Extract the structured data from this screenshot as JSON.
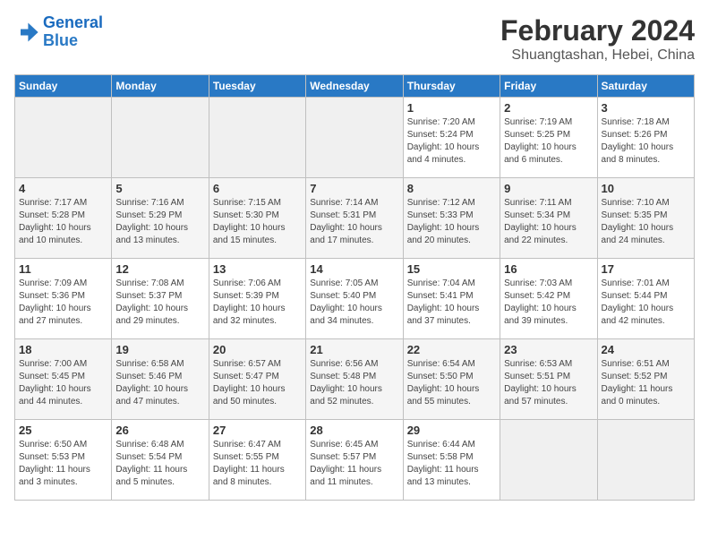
{
  "logo": {
    "line1": "General",
    "line2": "Blue"
  },
  "title": "February 2024",
  "subtitle": "Shuangtashan, Hebei, China",
  "days_of_week": [
    "Sunday",
    "Monday",
    "Tuesday",
    "Wednesday",
    "Thursday",
    "Friday",
    "Saturday"
  ],
  "weeks": [
    [
      {
        "day": "",
        "info": ""
      },
      {
        "day": "",
        "info": ""
      },
      {
        "day": "",
        "info": ""
      },
      {
        "day": "",
        "info": ""
      },
      {
        "day": "1",
        "info": "Sunrise: 7:20 AM\nSunset: 5:24 PM\nDaylight: 10 hours\nand 4 minutes."
      },
      {
        "day": "2",
        "info": "Sunrise: 7:19 AM\nSunset: 5:25 PM\nDaylight: 10 hours\nand 6 minutes."
      },
      {
        "day": "3",
        "info": "Sunrise: 7:18 AM\nSunset: 5:26 PM\nDaylight: 10 hours\nand 8 minutes."
      }
    ],
    [
      {
        "day": "4",
        "info": "Sunrise: 7:17 AM\nSunset: 5:28 PM\nDaylight: 10 hours\nand 10 minutes."
      },
      {
        "day": "5",
        "info": "Sunrise: 7:16 AM\nSunset: 5:29 PM\nDaylight: 10 hours\nand 13 minutes."
      },
      {
        "day": "6",
        "info": "Sunrise: 7:15 AM\nSunset: 5:30 PM\nDaylight: 10 hours\nand 15 minutes."
      },
      {
        "day": "7",
        "info": "Sunrise: 7:14 AM\nSunset: 5:31 PM\nDaylight: 10 hours\nand 17 minutes."
      },
      {
        "day": "8",
        "info": "Sunrise: 7:12 AM\nSunset: 5:33 PM\nDaylight: 10 hours\nand 20 minutes."
      },
      {
        "day": "9",
        "info": "Sunrise: 7:11 AM\nSunset: 5:34 PM\nDaylight: 10 hours\nand 22 minutes."
      },
      {
        "day": "10",
        "info": "Sunrise: 7:10 AM\nSunset: 5:35 PM\nDaylight: 10 hours\nand 24 minutes."
      }
    ],
    [
      {
        "day": "11",
        "info": "Sunrise: 7:09 AM\nSunset: 5:36 PM\nDaylight: 10 hours\nand 27 minutes."
      },
      {
        "day": "12",
        "info": "Sunrise: 7:08 AM\nSunset: 5:37 PM\nDaylight: 10 hours\nand 29 minutes."
      },
      {
        "day": "13",
        "info": "Sunrise: 7:06 AM\nSunset: 5:39 PM\nDaylight: 10 hours\nand 32 minutes."
      },
      {
        "day": "14",
        "info": "Sunrise: 7:05 AM\nSunset: 5:40 PM\nDaylight: 10 hours\nand 34 minutes."
      },
      {
        "day": "15",
        "info": "Sunrise: 7:04 AM\nSunset: 5:41 PM\nDaylight: 10 hours\nand 37 minutes."
      },
      {
        "day": "16",
        "info": "Sunrise: 7:03 AM\nSunset: 5:42 PM\nDaylight: 10 hours\nand 39 minutes."
      },
      {
        "day": "17",
        "info": "Sunrise: 7:01 AM\nSunset: 5:44 PM\nDaylight: 10 hours\nand 42 minutes."
      }
    ],
    [
      {
        "day": "18",
        "info": "Sunrise: 7:00 AM\nSunset: 5:45 PM\nDaylight: 10 hours\nand 44 minutes."
      },
      {
        "day": "19",
        "info": "Sunrise: 6:58 AM\nSunset: 5:46 PM\nDaylight: 10 hours\nand 47 minutes."
      },
      {
        "day": "20",
        "info": "Sunrise: 6:57 AM\nSunset: 5:47 PM\nDaylight: 10 hours\nand 50 minutes."
      },
      {
        "day": "21",
        "info": "Sunrise: 6:56 AM\nSunset: 5:48 PM\nDaylight: 10 hours\nand 52 minutes."
      },
      {
        "day": "22",
        "info": "Sunrise: 6:54 AM\nSunset: 5:50 PM\nDaylight: 10 hours\nand 55 minutes."
      },
      {
        "day": "23",
        "info": "Sunrise: 6:53 AM\nSunset: 5:51 PM\nDaylight: 10 hours\nand 57 minutes."
      },
      {
        "day": "24",
        "info": "Sunrise: 6:51 AM\nSunset: 5:52 PM\nDaylight: 11 hours\nand 0 minutes."
      }
    ],
    [
      {
        "day": "25",
        "info": "Sunrise: 6:50 AM\nSunset: 5:53 PM\nDaylight: 11 hours\nand 3 minutes."
      },
      {
        "day": "26",
        "info": "Sunrise: 6:48 AM\nSunset: 5:54 PM\nDaylight: 11 hours\nand 5 minutes."
      },
      {
        "day": "27",
        "info": "Sunrise: 6:47 AM\nSunset: 5:55 PM\nDaylight: 11 hours\nand 8 minutes."
      },
      {
        "day": "28",
        "info": "Sunrise: 6:45 AM\nSunset: 5:57 PM\nDaylight: 11 hours\nand 11 minutes."
      },
      {
        "day": "29",
        "info": "Sunrise: 6:44 AM\nSunset: 5:58 PM\nDaylight: 11 hours\nand 13 minutes."
      },
      {
        "day": "",
        "info": ""
      },
      {
        "day": "",
        "info": ""
      }
    ]
  ]
}
